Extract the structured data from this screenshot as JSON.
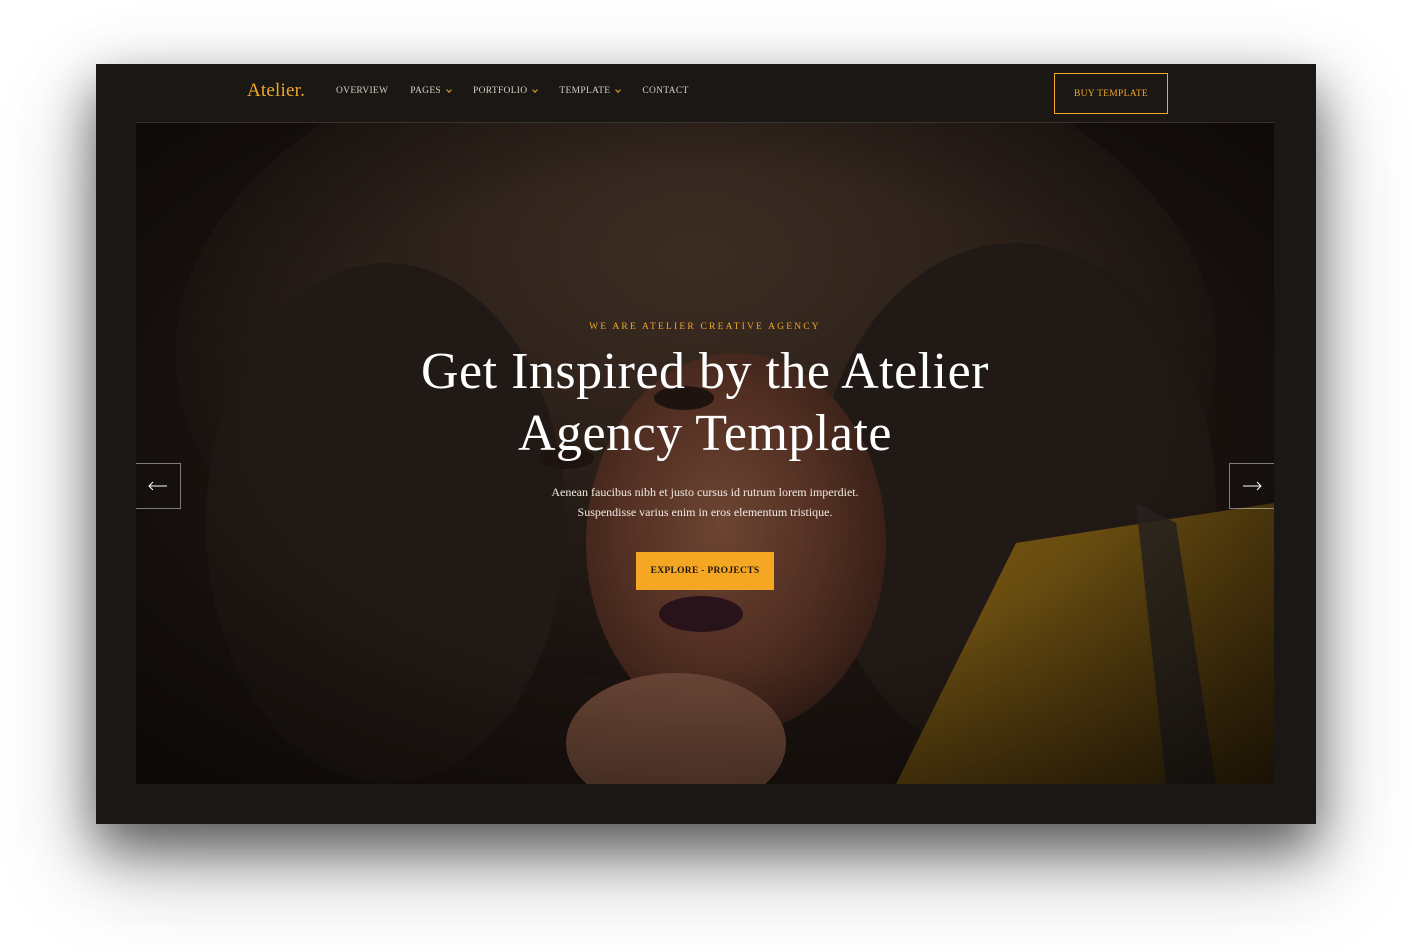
{
  "brand": {
    "logo_text": "Atelier."
  },
  "nav": {
    "items": [
      {
        "label": "OVERVIEW",
        "has_dropdown": false
      },
      {
        "label": "PAGES",
        "has_dropdown": true
      },
      {
        "label": "PORTFOLIO",
        "has_dropdown": true
      },
      {
        "label": "TEMPLATE",
        "has_dropdown": true
      },
      {
        "label": "CONTACT",
        "has_dropdown": false
      }
    ],
    "cta_label": "BUY TEMPLATE"
  },
  "hero": {
    "eyebrow": "WE ARE ATELIER CREATIVE AGENCY",
    "headline_line1": "Get Inspired by the Atelier",
    "headline_line2": "Agency Template",
    "subtext_line1": "Aenean faucibus nibh et justo cursus id rutrum lorem imperdiet.",
    "subtext_line2": "Suspendisse varius enim in eros elementum tristique.",
    "cta_label": "EXPLORE - PROJECTS",
    "prev_icon": "arrow-left-icon",
    "next_icon": "arrow-right-icon"
  },
  "colors": {
    "accent": "#f5a623",
    "background": "#1b1714",
    "text_light": "#ffffff"
  }
}
